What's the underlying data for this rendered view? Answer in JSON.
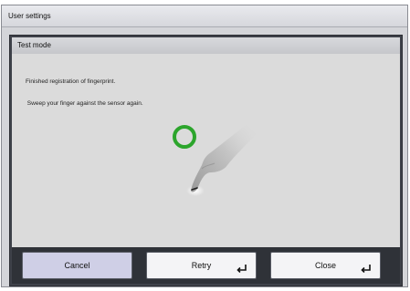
{
  "window": {
    "title": "User settings"
  },
  "dialog": {
    "title": "Test mode",
    "message_line1": "Finished registration of fingerprint.",
    "message_line2": " Sweep your finger against the sensor again."
  },
  "graphic": {
    "ring_color": "#2ca52c",
    "ring_icon": "status-ring-icon",
    "finger_icon": "finger-swipe-icon"
  },
  "buttons": {
    "cancel_label": "Cancel",
    "retry_label": "Retry",
    "close_label": "Close",
    "enter_icon": "enter-key-icon"
  }
}
